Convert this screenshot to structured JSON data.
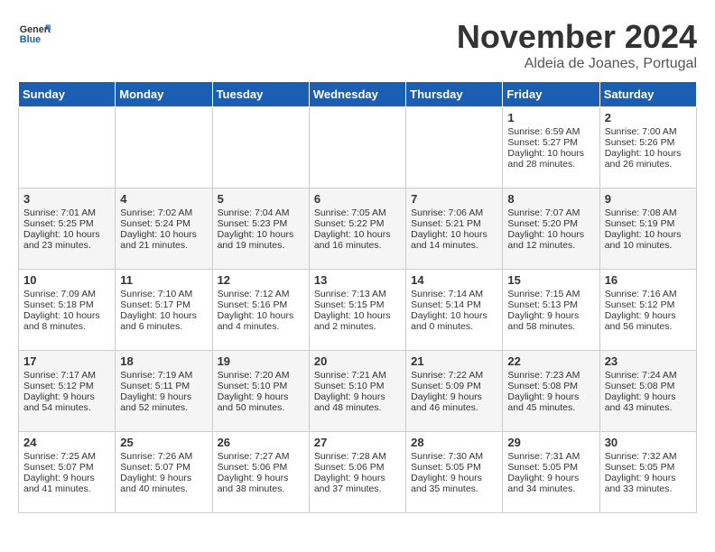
{
  "header": {
    "logo_general": "General",
    "logo_blue": "Blue",
    "month": "November 2024",
    "location": "Aldeia de Joanes, Portugal"
  },
  "days_of_week": [
    "Sunday",
    "Monday",
    "Tuesday",
    "Wednesday",
    "Thursday",
    "Friday",
    "Saturday"
  ],
  "weeks": [
    [
      {
        "day": "",
        "info": ""
      },
      {
        "day": "",
        "info": ""
      },
      {
        "day": "",
        "info": ""
      },
      {
        "day": "",
        "info": ""
      },
      {
        "day": "",
        "info": ""
      },
      {
        "day": "1",
        "info": "Sunrise: 6:59 AM\nSunset: 5:27 PM\nDaylight: 10 hours and 28 minutes."
      },
      {
        "day": "2",
        "info": "Sunrise: 7:00 AM\nSunset: 5:26 PM\nDaylight: 10 hours and 26 minutes."
      }
    ],
    [
      {
        "day": "3",
        "info": "Sunrise: 7:01 AM\nSunset: 5:25 PM\nDaylight: 10 hours and 23 minutes."
      },
      {
        "day": "4",
        "info": "Sunrise: 7:02 AM\nSunset: 5:24 PM\nDaylight: 10 hours and 21 minutes."
      },
      {
        "day": "5",
        "info": "Sunrise: 7:04 AM\nSunset: 5:23 PM\nDaylight: 10 hours and 19 minutes."
      },
      {
        "day": "6",
        "info": "Sunrise: 7:05 AM\nSunset: 5:22 PM\nDaylight: 10 hours and 16 minutes."
      },
      {
        "day": "7",
        "info": "Sunrise: 7:06 AM\nSunset: 5:21 PM\nDaylight: 10 hours and 14 minutes."
      },
      {
        "day": "8",
        "info": "Sunrise: 7:07 AM\nSunset: 5:20 PM\nDaylight: 10 hours and 12 minutes."
      },
      {
        "day": "9",
        "info": "Sunrise: 7:08 AM\nSunset: 5:19 PM\nDaylight: 10 hours and 10 minutes."
      }
    ],
    [
      {
        "day": "10",
        "info": "Sunrise: 7:09 AM\nSunset: 5:18 PM\nDaylight: 10 hours and 8 minutes."
      },
      {
        "day": "11",
        "info": "Sunrise: 7:10 AM\nSunset: 5:17 PM\nDaylight: 10 hours and 6 minutes."
      },
      {
        "day": "12",
        "info": "Sunrise: 7:12 AM\nSunset: 5:16 PM\nDaylight: 10 hours and 4 minutes."
      },
      {
        "day": "13",
        "info": "Sunrise: 7:13 AM\nSunset: 5:15 PM\nDaylight: 10 hours and 2 minutes."
      },
      {
        "day": "14",
        "info": "Sunrise: 7:14 AM\nSunset: 5:14 PM\nDaylight: 10 hours and 0 minutes."
      },
      {
        "day": "15",
        "info": "Sunrise: 7:15 AM\nSunset: 5:13 PM\nDaylight: 9 hours and 58 minutes."
      },
      {
        "day": "16",
        "info": "Sunrise: 7:16 AM\nSunset: 5:12 PM\nDaylight: 9 hours and 56 minutes."
      }
    ],
    [
      {
        "day": "17",
        "info": "Sunrise: 7:17 AM\nSunset: 5:12 PM\nDaylight: 9 hours and 54 minutes."
      },
      {
        "day": "18",
        "info": "Sunrise: 7:19 AM\nSunset: 5:11 PM\nDaylight: 9 hours and 52 minutes."
      },
      {
        "day": "19",
        "info": "Sunrise: 7:20 AM\nSunset: 5:10 PM\nDaylight: 9 hours and 50 minutes."
      },
      {
        "day": "20",
        "info": "Sunrise: 7:21 AM\nSunset: 5:10 PM\nDaylight: 9 hours and 48 minutes."
      },
      {
        "day": "21",
        "info": "Sunrise: 7:22 AM\nSunset: 5:09 PM\nDaylight: 9 hours and 46 minutes."
      },
      {
        "day": "22",
        "info": "Sunrise: 7:23 AM\nSunset: 5:08 PM\nDaylight: 9 hours and 45 minutes."
      },
      {
        "day": "23",
        "info": "Sunrise: 7:24 AM\nSunset: 5:08 PM\nDaylight: 9 hours and 43 minutes."
      }
    ],
    [
      {
        "day": "24",
        "info": "Sunrise: 7:25 AM\nSunset: 5:07 PM\nDaylight: 9 hours and 41 minutes."
      },
      {
        "day": "25",
        "info": "Sunrise: 7:26 AM\nSunset: 5:07 PM\nDaylight: 9 hours and 40 minutes."
      },
      {
        "day": "26",
        "info": "Sunrise: 7:27 AM\nSunset: 5:06 PM\nDaylight: 9 hours and 38 minutes."
      },
      {
        "day": "27",
        "info": "Sunrise: 7:28 AM\nSunset: 5:06 PM\nDaylight: 9 hours and 37 minutes."
      },
      {
        "day": "28",
        "info": "Sunrise: 7:30 AM\nSunset: 5:05 PM\nDaylight: 9 hours and 35 minutes."
      },
      {
        "day": "29",
        "info": "Sunrise: 7:31 AM\nSunset: 5:05 PM\nDaylight: 9 hours and 34 minutes."
      },
      {
        "day": "30",
        "info": "Sunrise: 7:32 AM\nSunset: 5:05 PM\nDaylight: 9 hours and 33 minutes."
      }
    ]
  ]
}
